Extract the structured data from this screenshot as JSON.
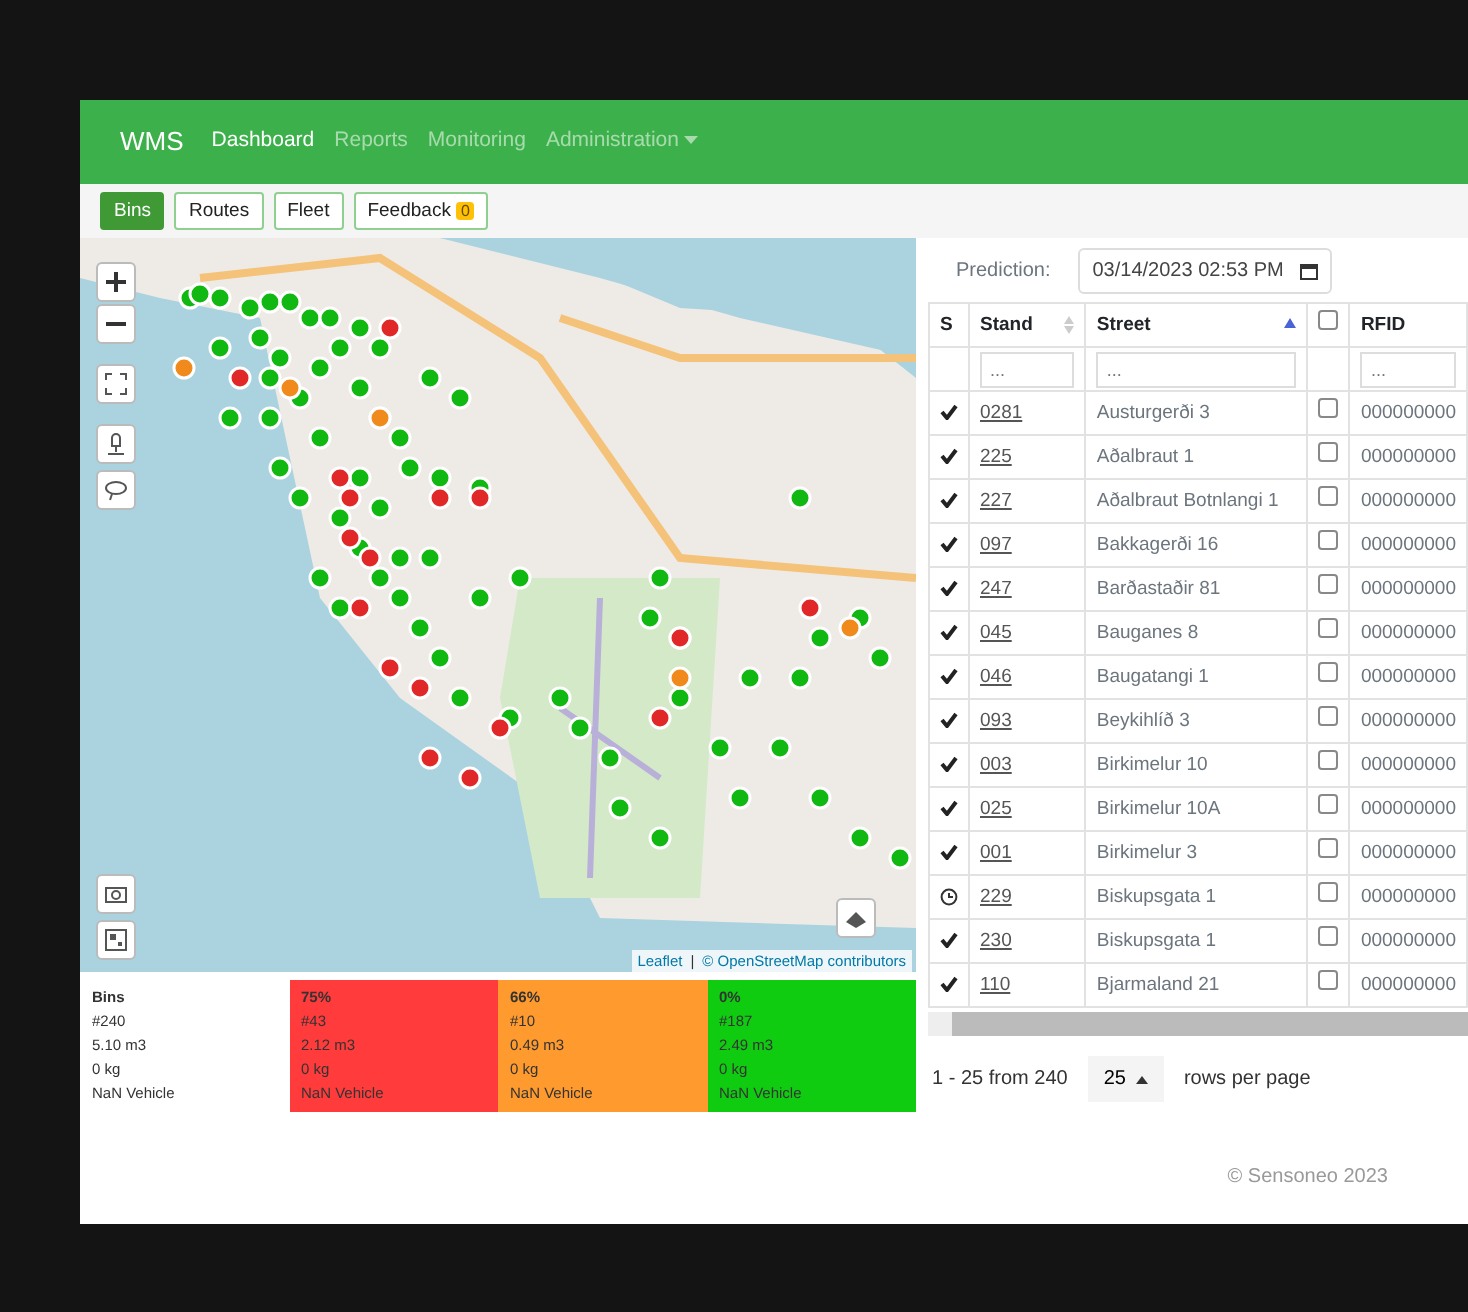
{
  "navbar": {
    "brand": "WMS",
    "items": [
      {
        "label": "Dashboard",
        "selected": true,
        "has_menu": false
      },
      {
        "label": "Reports",
        "selected": false,
        "has_menu": false
      },
      {
        "label": "Monitoring",
        "selected": false,
        "has_menu": false
      },
      {
        "label": "Administration",
        "selected": false,
        "has_menu": true
      }
    ]
  },
  "toolbar": [
    {
      "label": "Bins",
      "selected": true
    },
    {
      "label": "Routes",
      "selected": false
    },
    {
      "label": "Fleet",
      "selected": false
    },
    {
      "label": "Feedback",
      "selected": false,
      "badge": "0"
    }
  ],
  "map": {
    "attribution_link": "Leaflet",
    "attribution_sep": "|",
    "attribution_text": "© OpenStreetMap contributors"
  },
  "summary": [
    {
      "title": "Bins",
      "color": "#ffffff",
      "lines": [
        "#240",
        "5.10 m3",
        "0 kg",
        "NaN Vehicle"
      ]
    },
    {
      "title": "75%",
      "color": "#ff3b3b",
      "lines": [
        "#43",
        "2.12 m3",
        "0 kg",
        "NaN Vehicle"
      ]
    },
    {
      "title": "66%",
      "color": "#ff9a2e",
      "lines": [
        "#10",
        "0.49 m3",
        "0 kg",
        "NaN Vehicle"
      ]
    },
    {
      "title": "0%",
      "color": "#10cc10",
      "lines": [
        "#187",
        "2.49 m3",
        "0 kg",
        "NaN Vehicle"
      ]
    }
  ],
  "prediction": {
    "label": "Prediction:",
    "value": "03/14/2023 02:53 PM"
  },
  "table": {
    "columns": [
      "S",
      "Stand",
      "Street",
      "RFID"
    ],
    "select_all_checked": false,
    "filters": [
      {
        "placeholder": "..."
      },
      {
        "placeholder": "..."
      },
      {
        "placeholder": "..."
      }
    ],
    "rows": [
      {
        "done": true,
        "stand": "0281",
        "street": "Austurgerði 3",
        "checked": false,
        "rfid": "000000000"
      },
      {
        "done": true,
        "stand": "225",
        "street": "Aðalbraut 1",
        "checked": false,
        "rfid": "000000000"
      },
      {
        "done": true,
        "stand": "227",
        "street": "Aðalbraut Botnlangi 1",
        "checked": false,
        "rfid": "000000000"
      },
      {
        "done": true,
        "stand": "097",
        "street": "Bakkagerði 16",
        "checked": false,
        "rfid": "000000000"
      },
      {
        "done": true,
        "stand": "247",
        "street": "Barðastaðir 81",
        "checked": false,
        "rfid": "000000000"
      },
      {
        "done": true,
        "stand": "045",
        "street": "Bauganes 8",
        "checked": false,
        "rfid": "000000000"
      },
      {
        "done": true,
        "stand": "046",
        "street": "Baugatangi 1",
        "checked": false,
        "rfid": "000000000"
      },
      {
        "done": true,
        "stand": "093",
        "street": "Beykihlíð 3",
        "checked": false,
        "rfid": "000000000"
      },
      {
        "done": true,
        "stand": "003",
        "street": "Birkimelur 10",
        "checked": false,
        "rfid": "000000000"
      },
      {
        "done": true,
        "stand": "025",
        "street": "Birkimelur 10A",
        "checked": false,
        "rfid": "000000000"
      },
      {
        "done": true,
        "stand": "001",
        "street": "Birkimelur 3",
        "checked": false,
        "rfid": "000000000"
      },
      {
        "done": false,
        "stand": "229",
        "street": "Biskupsgata 1",
        "checked": false,
        "rfid": "000000000"
      },
      {
        "done": true,
        "stand": "230",
        "street": "Biskupsgata 1",
        "checked": false,
        "rfid": "000000000"
      },
      {
        "done": true,
        "stand": "110",
        "street": "Bjarmaland 21",
        "checked": false,
        "rfid": "000000000"
      }
    ]
  },
  "pagination": {
    "range": "1 - 25 from 240",
    "page_size": "25",
    "suffix": "rows per page"
  },
  "footer": "© Sensoneo 2023"
}
